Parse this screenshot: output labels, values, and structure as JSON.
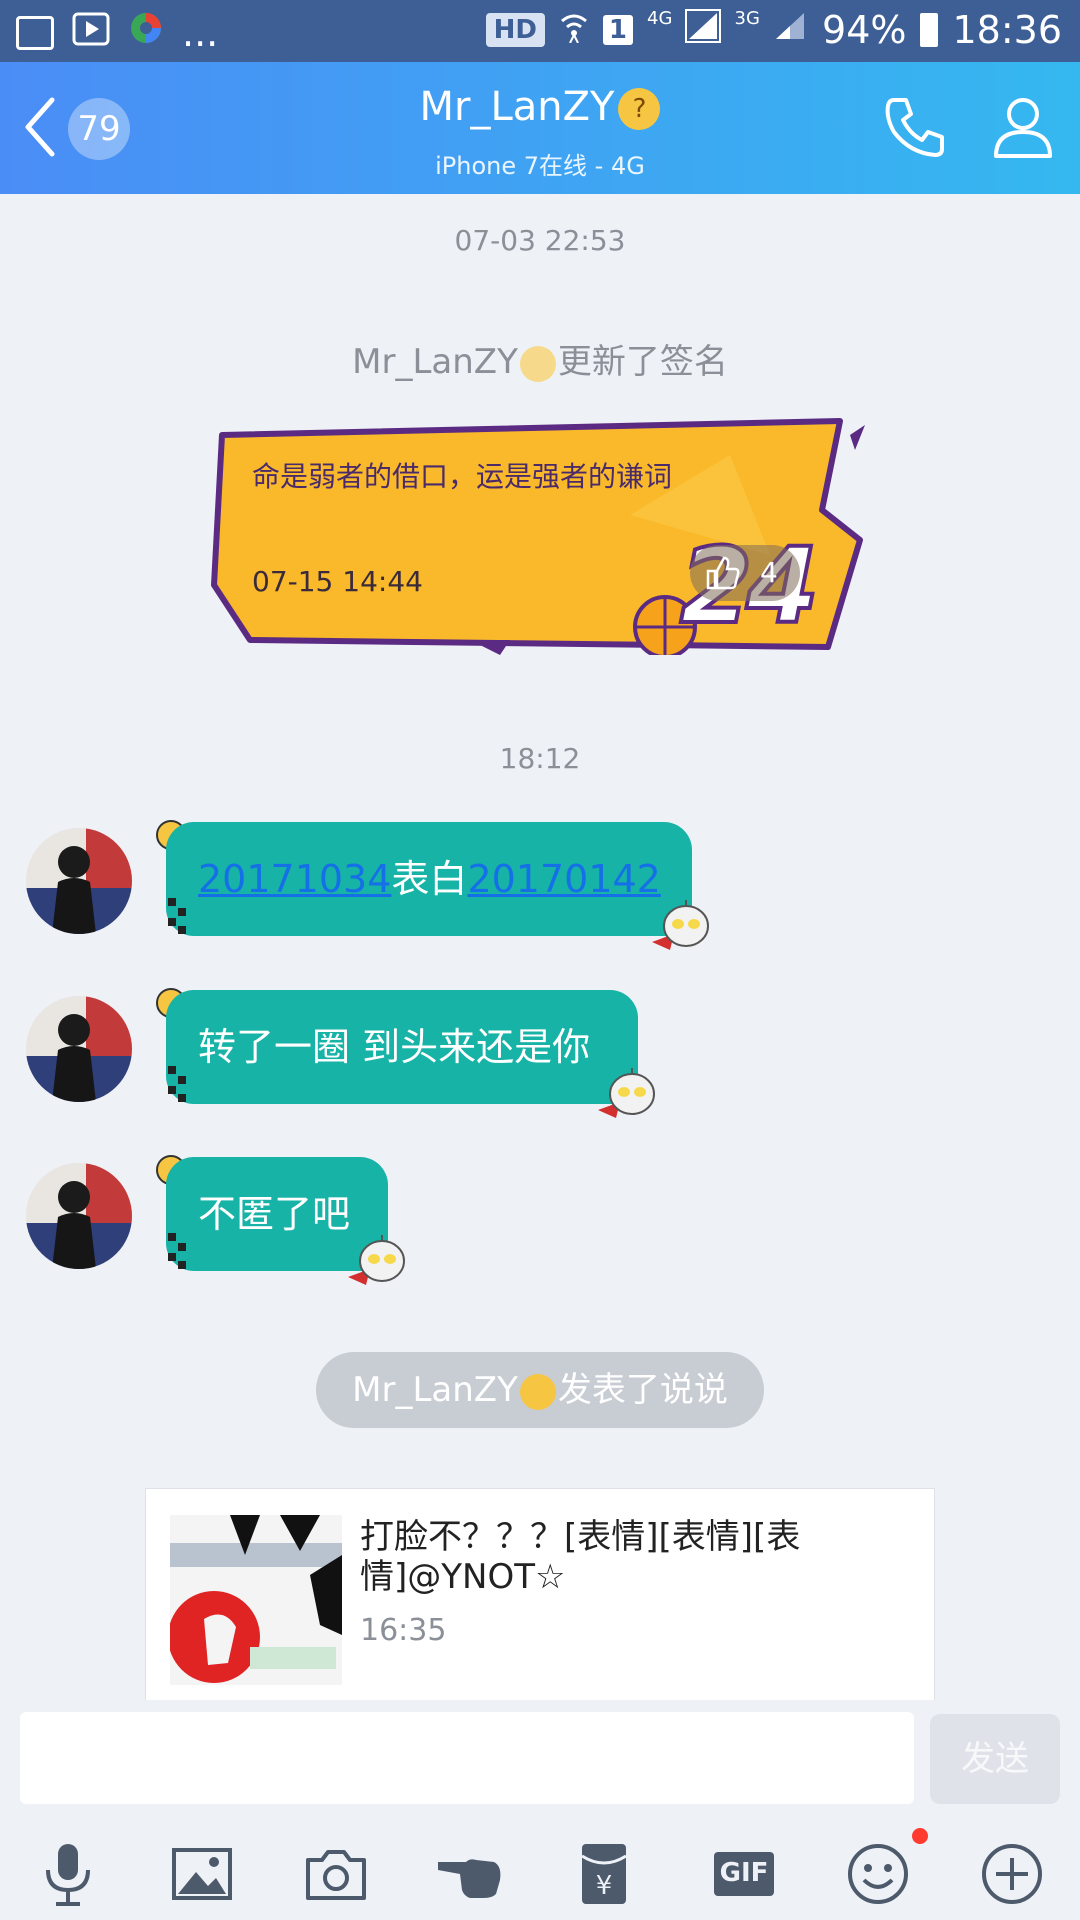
{
  "status_bar": {
    "notifications": [
      "gallery-icon",
      "video-icon",
      "colorful-app-icon"
    ],
    "more": "...",
    "hd": "HD",
    "sim": "1",
    "network1": "4G",
    "network2": "3G",
    "battery": "94%",
    "time": "18:36"
  },
  "header": {
    "unread_count": "79",
    "title": "Mr_LanZY",
    "subtitle": "iPhone 7在线 - 4G",
    "title_emoji": "thinking-face"
  },
  "messages": {
    "time1": "07-03 22:53",
    "signature_prefix": "Mr_LanZY",
    "signature_suffix": "更新了签名",
    "signature_text": "命是弱者的借口，运是强者的谦词",
    "signature_time": "07-15 14:44",
    "signature_likes": "4",
    "signature_number": "24",
    "time2": "18:12",
    "msg1_link1": "20171034",
    "msg1_mid": "表白",
    "msg1_link2": "20170142",
    "msg2": "转了一圈 到头来还是你",
    "msg3": "不匿了吧",
    "feed_prefix": "Mr_LanZY",
    "feed_suffix": "发表了说说",
    "feed_text": "打脸不？？？[表情][表情][表情]@YNOT☆",
    "feed_time": "16:35"
  },
  "input": {
    "placeholder": "",
    "send_label": "发送"
  },
  "toolbar": {
    "gif_label": "GIF"
  },
  "colors": {
    "header_start": "#4a8df6",
    "header_end": "#35b8f0",
    "bubble": "#17b3a7",
    "link": "#1570e8",
    "signature_card": "#f9b92a",
    "notification_dot": "#ff3b30"
  }
}
